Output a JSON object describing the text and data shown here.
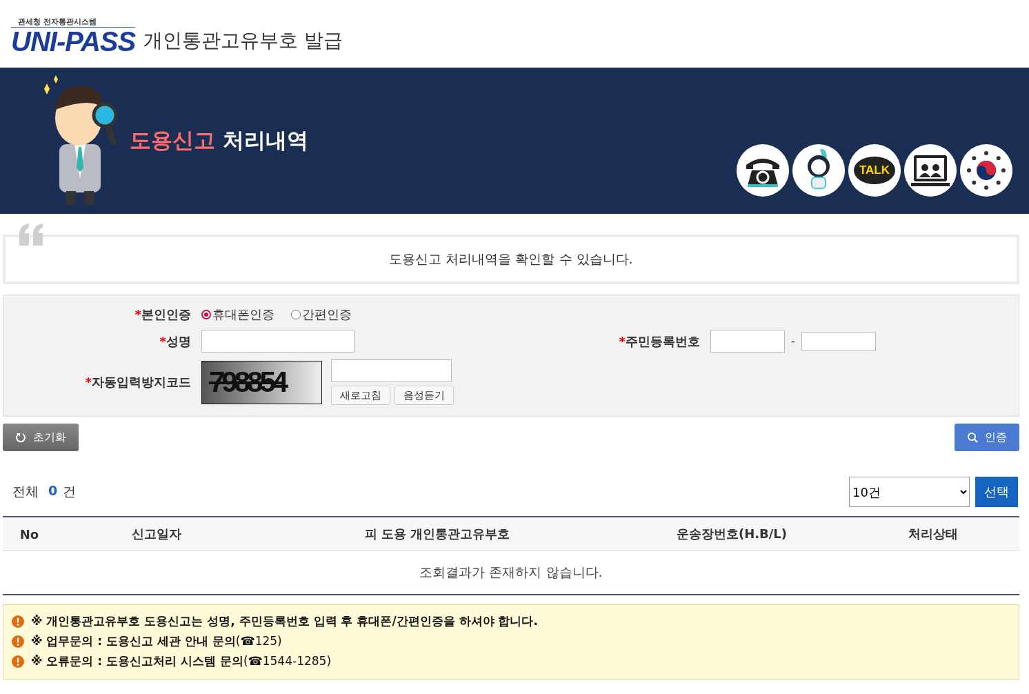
{
  "header": {
    "logo_caption": "관세청 전자통관시스템",
    "logo_text": "UNI-PASS",
    "title": "개인통관고유부호 발급"
  },
  "banner": {
    "title_highlight": "도용신고",
    "title_rest": "처리내역",
    "quick_links": [
      {
        "kind": "phone"
      },
      {
        "kind": "mascot"
      },
      {
        "kind": "talk",
        "label": "TALK"
      },
      {
        "kind": "video"
      },
      {
        "kind": "emblem"
      }
    ]
  },
  "intro": "도용신고 처리내역을 확인할 수 있습니다.",
  "form": {
    "auth": {
      "mark": "*",
      "label": "본인인증",
      "options": [
        {
          "label": "휴대폰인증",
          "selected": true
        },
        {
          "label": "간편인증",
          "selected": false
        }
      ]
    },
    "name": {
      "mark": "*",
      "label": "성명"
    },
    "rrn": {
      "mark": "*",
      "label": "주민등록번호",
      "separator": "-"
    },
    "captcha": {
      "mark": "*",
      "label": "자동입력방지코드",
      "code": "798854",
      "buttons": [
        "새로고침",
        "음성듣기"
      ]
    }
  },
  "reset_button": "초기화",
  "auth_button": "인증",
  "results": {
    "total_label": "전체",
    "count": "0",
    "unit": "건",
    "page_size": "10건",
    "select_button": "선택",
    "columns": [
      "No",
      "신고일자",
      "피 도용 개인통관고유부호",
      "운송장번호(H.B/L)",
      "처리상태"
    ],
    "empty_message": "조회결과가 존재하지 않습니다."
  },
  "notices": [
    "※ 개인통관고유부호 도용신고는 성명, 주민등록번호 입력 후 휴대폰/간편인증을 하셔야 합니다.",
    "**※ 업무문의 : 도용신고 세관 안내 문의**(☎125)",
    "**※ 오류문의 : 도용신고처리 시스템 문의**(☎1544-1285)"
  ]
}
